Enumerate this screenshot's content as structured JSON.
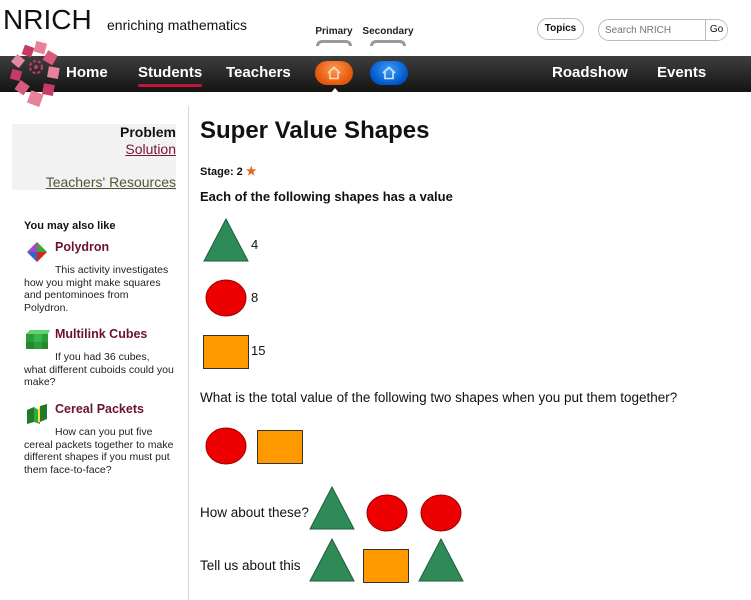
{
  "brand": {
    "name": "NRICH",
    "tagline": "enriching mathematics",
    "colors": {
      "navbar": "#1f1f1f",
      "accent": "#c0173a",
      "primary_pill": "#e4560a",
      "secondary_pill": "#0057c8",
      "link": "#7a1535"
    }
  },
  "audience": {
    "primary": "Primary",
    "secondary": "Secondary"
  },
  "header": {
    "topics": "Topics",
    "search_placeholder": "Search NRICH",
    "search_go": "Go"
  },
  "nav": {
    "home": "Home",
    "students": "Students",
    "teachers": "Teachers",
    "roadshow": "Roadshow",
    "events": "Events",
    "active": "students",
    "primary_icon": "house-icon",
    "secondary_icon": "house-icon"
  },
  "sidebar": {
    "resources": {
      "problem": "Problem",
      "solution": "Solution",
      "teachers": "Teachers' Resources"
    },
    "also_like_heading": "You may also like",
    "related": [
      {
        "title": "Polydron",
        "icon": "polydron-icon",
        "desc": "This activity investigates how you might make squares and pentominoes from Polydron."
      },
      {
        "title": "Multilink Cubes",
        "icon": "multilink-cubes-icon",
        "desc": "If you had 36 cubes, what different cuboids could you make?"
      },
      {
        "title": "Cereal Packets",
        "icon": "cereal-packets-icon",
        "desc": "How can you put five cereal packets together to make different shapes if you must put them face-to-face?"
      }
    ]
  },
  "main": {
    "title": "Super Value Shapes",
    "stage_label": "Stage: 2",
    "stage_star": "★",
    "intro": "Each of the following shapes has a value",
    "shape_values": [
      {
        "shape": "triangle",
        "color": "#2e8b57",
        "value": "4"
      },
      {
        "shape": "circle",
        "color": "#ee0000",
        "value": "8"
      },
      {
        "shape": "rectangle",
        "color": "#ff9900",
        "value": "15"
      }
    ],
    "question": "What is the total value of the following two shapes when you put them together?",
    "question_shapes": [
      "circle",
      "rectangle"
    ],
    "row2_label": "How about these?",
    "row2_shapes": [
      "triangle",
      "circle",
      "circle"
    ],
    "row3_label": "Tell us about this",
    "row3_shapes": [
      "triangle",
      "rectangle",
      "triangle"
    ]
  }
}
